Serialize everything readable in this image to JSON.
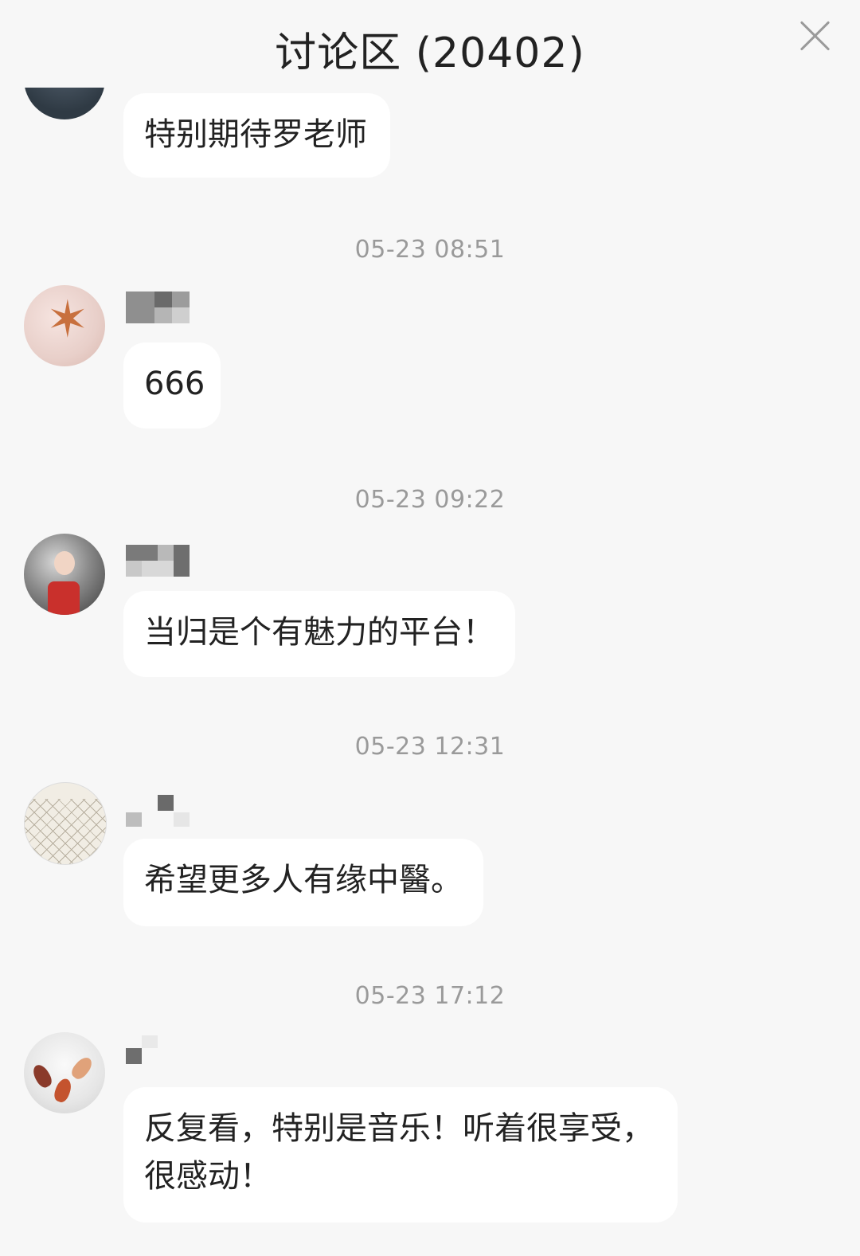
{
  "header": {
    "title": "讨论区 (20402)"
  },
  "messages": [
    {
      "text": "特别期待罗老师"
    },
    {
      "text": "666"
    },
    {
      "text": "当归是个有魅力的平台！"
    },
    {
      "text": "希望更多人有缘中醫。"
    },
    {
      "text": "反复看，特别是音乐！听着很享受，很感动！"
    }
  ],
  "timestamps": [
    "05-23 08:51",
    "05-23 09:22",
    "05-23 12:31",
    "05-23 17:12"
  ],
  "icons": {
    "close": "close-icon"
  }
}
